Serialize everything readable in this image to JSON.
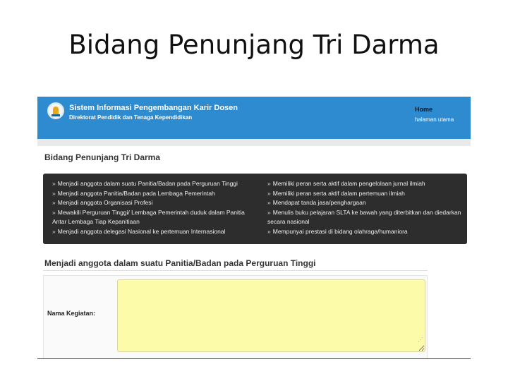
{
  "slide": {
    "title": "Bidang Penunjang Tri Darma"
  },
  "header": {
    "system_title": "Sistem Informasi Pengembangan Karir Dosen",
    "system_subtitle": "Direktorat Pendidik dan Tenaga Kependidikan",
    "nav_home": "Home",
    "nav_home_sub": "halaman utama",
    "logo_icon": "emblem-icon",
    "bar_color": "#2f8bd0"
  },
  "section": {
    "title": "Bidang Penunjang Tri Darma"
  },
  "menu": {
    "bullet": "»",
    "left_items": [
      "Menjadi anggota dalam suatu Panitia/Badan pada Perguruan Tinggi",
      "Menjadi anggota Panitia/Badan pada Lembaga Pemerintah",
      "Menjadi anggota Organisasi Profesi",
      "Mewakili Perguruan Tinggi/ Lembaga Pemerintah duduk dalam Panitia Antar Lembaga Tiap Kepanitiaan",
      "Menjadi anggota delegasi Nasional ke pertemuan Internasional"
    ],
    "right_items": [
      "Memiliki peran serta aktif dalam pengelolaan jurnal ilmiah",
      "Memiliki peran serta aktif dalam pertemuan ilmiah",
      "Mendapat tanda jasa/penghargaan",
      "Menulis buku pelajaran SLTA ke bawah yang diterbitkan dan diedarkan secara nasional",
      "Mempunyai prestasi di bidang olahraga/humaniora"
    ]
  },
  "form": {
    "title": "Menjadi anggota dalam suatu Panitia/Badan pada Perguruan Tinggi",
    "field_label": "Nama Kegiatan:",
    "field_value": "",
    "field_color": "#fbfba9"
  }
}
